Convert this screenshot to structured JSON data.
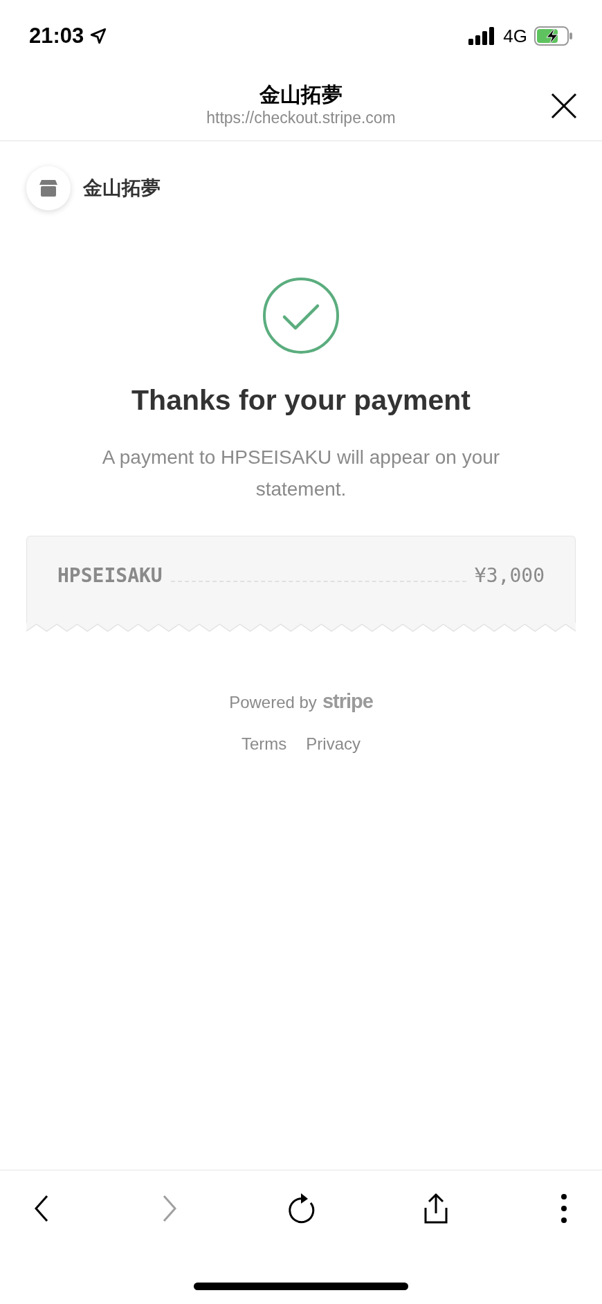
{
  "status_bar": {
    "time": "21:03",
    "network": "4G"
  },
  "browser_header": {
    "title": "金山拓夢",
    "url": "https://checkout.stripe.com"
  },
  "merchant": {
    "name": "金山拓夢"
  },
  "confirmation": {
    "heading": "Thanks for your payment",
    "message": "A payment to HPSEISAKU will appear on your statement."
  },
  "receipt": {
    "label": "HPSEISAKU",
    "amount": "¥3,000"
  },
  "footer": {
    "powered_by": "Powered by",
    "brand": "stripe",
    "links": [
      "Terms",
      "Privacy"
    ]
  },
  "toolbar": {
    "back_disabled": false,
    "forward_disabled": true
  }
}
